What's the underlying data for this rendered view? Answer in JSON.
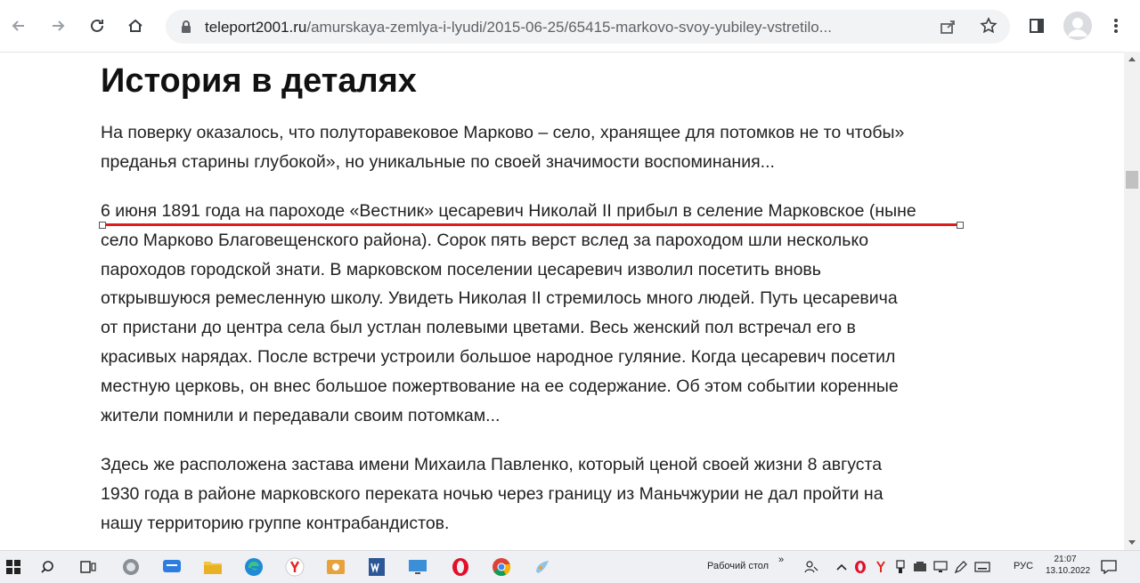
{
  "browser": {
    "url_domain": "teleport2001.ru",
    "url_path": "/amurskaya-zemlya-i-lyudi/2015-06-25/65415-markovo-svoy-yubiley-vstretilo..."
  },
  "article": {
    "heading": "История в деталях",
    "p1": [
      "На поверку оказалось, что полуторавековое Марково – село, хранящее для потомков не то чтобы»",
      "преданья старины глубокой», но уникальные по своей значимости воспоминания..."
    ],
    "p2": [
      "6 июня 1891 года на пароходе «Вестник» цесаревич Николай II прибыл в селение Марковское (ныне",
      "село Марково Благовещенского района). Сорок пять  верст вслед за пароходом шли несколько",
      "пароходов городской знати. В марковском поселении цесаревич изволил посетить вновь",
      "открывшуюся ремесленную школу.  Увидеть Николая II стремилось много людей. Путь цесаревича",
      "от пристани до центра села был устлан полевыми цветами. Весь женский пол встречал его в",
      "красивых нарядах. После встречи устроили большое народное гуляние. Когда цесаревич посетил",
      "местную церковь, он внес большое пожертвование на ее содержание. Об этом событии коренные",
      "жители помнили и передавали своим потомкам..."
    ],
    "p3": [
      "Здесь же расположена застава имени Михаила Павленко, который ценой своей жизни 8 августа",
      "1930 года в районе марковского переката ночью через границу из Маньчжурии не дал пройти на",
      "нашу территорию группе контрабандистов."
    ]
  },
  "taskbar": {
    "desktop_label": "Рабочий стол",
    "lang": "РУС",
    "time": "21:07",
    "date": "13.10.2022"
  },
  "colors": {
    "underline": "#e01b1b",
    "yandex": "#e52620",
    "opera": "#e0102a",
    "word": "#2b5797",
    "edge": "#1f8ad6"
  }
}
